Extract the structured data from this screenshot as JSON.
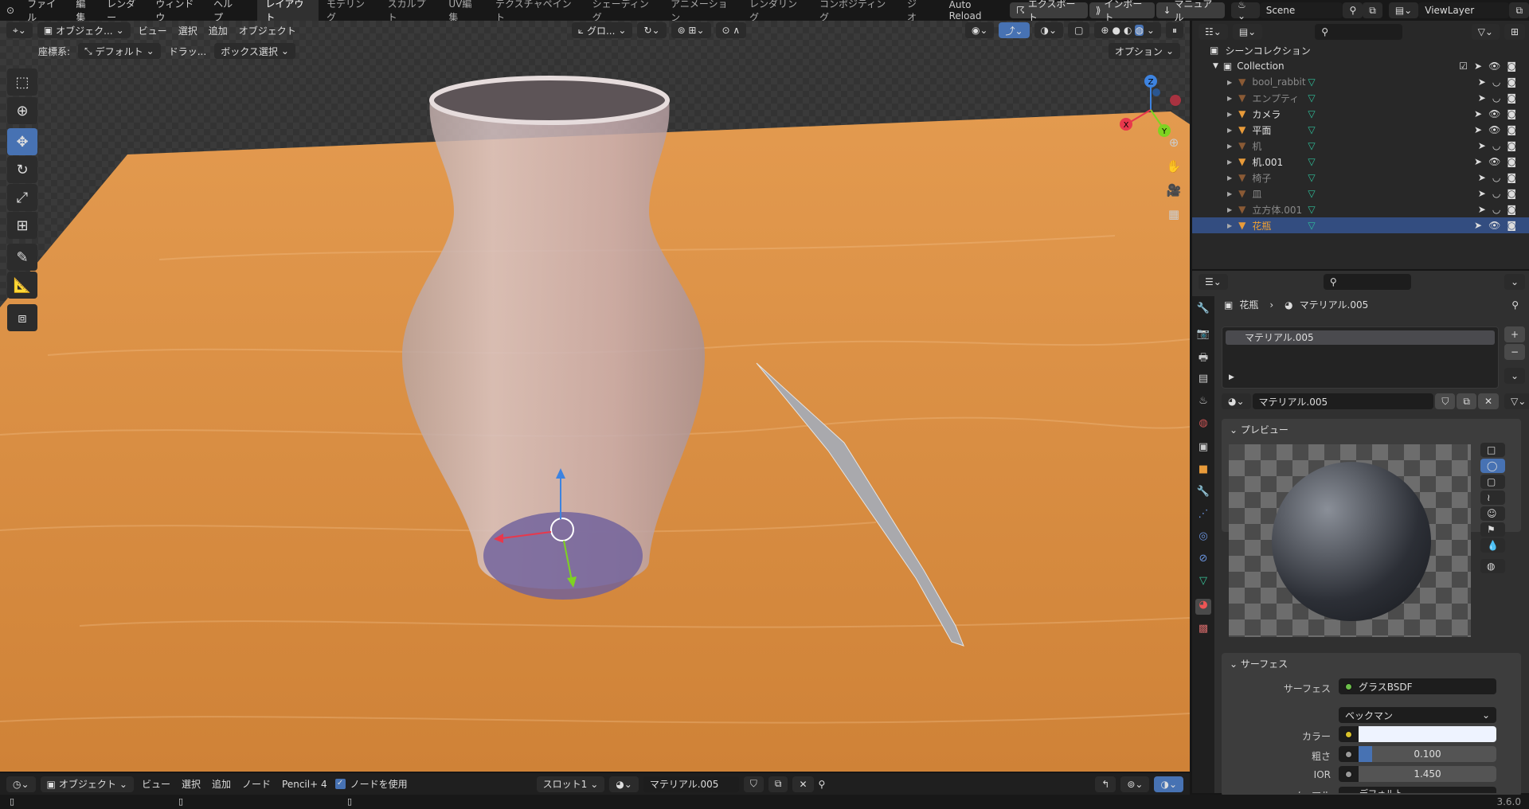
{
  "topbar": {
    "menus": [
      "ファイル",
      "編集",
      "レンダー",
      "ウィンドウ",
      "ヘルプ"
    ],
    "workspaces": [
      "レイアウト",
      "モデリング",
      "スカルプト",
      "UV編集",
      "テクスチャペイント",
      "シェーディング",
      "アニメーション",
      "レンダリング",
      "コンポジティング",
      "ジオ"
    ],
    "active_workspace": "レイアウト",
    "auto_reload": "Auto Reload",
    "export": "エクスポート",
    "import": "インポート",
    "manual": "マニュアル",
    "scene": "Scene",
    "view_layer": "ViewLayer"
  },
  "viewport": {
    "mode": "オブジェク...",
    "menus": [
      "ビュー",
      "選択",
      "追加",
      "オブジェクト"
    ],
    "transform_orientation": "グロ...",
    "coord_label": "座標系:",
    "coord_value": "デフォルト",
    "drag_label": "ドラッ...",
    "select_mode": "ボックス選択",
    "options": "オプション",
    "gizmo": {
      "x": "X",
      "y": "Y",
      "z": "Z"
    },
    "colors": {
      "table": "#d9893f",
      "selected_accent": "#4772b3"
    }
  },
  "outliner": {
    "scene_collection": "シーンコレクション",
    "collection": "Collection",
    "items": [
      {
        "name": "bool_rabbit",
        "dim": true,
        "visible": false
      },
      {
        "name": "エンプティ",
        "dim": true,
        "visible": false
      },
      {
        "name": "カメラ",
        "dim": false,
        "visible": true
      },
      {
        "name": "平面",
        "dim": false,
        "visible": true
      },
      {
        "name": "机",
        "dim": true,
        "visible": false
      },
      {
        "name": "机.001",
        "dim": false,
        "visible": true
      },
      {
        "name": "椅子",
        "dim": true,
        "visible": false
      },
      {
        "name": "皿",
        "dim": true,
        "visible": false
      },
      {
        "name": "立方体.001",
        "dim": true,
        "visible": false
      },
      {
        "name": "花瓶",
        "dim": false,
        "visible": true,
        "selected": true
      }
    ]
  },
  "properties": {
    "object": "花瓶",
    "material": "マテリアル.005",
    "slot_item": "マテリアル.005",
    "material_field": "マテリアル.005",
    "preview_header": "プレビュー",
    "surface_header": "サーフェス",
    "surface_label": "サーフェス",
    "surface_value": "グラスBSDF",
    "distribution": "ベックマン",
    "color_label": "カラー",
    "color_value": "#eef3ff",
    "roughness_label": "粗さ",
    "roughness_value": "0.100",
    "roughness_fraction": 0.1,
    "ior_label": "IOR",
    "ior_value": "1.450",
    "normal_label": "ノーマル",
    "normal_value": "デフォルト"
  },
  "bottom": {
    "mode": "オブジェクト",
    "menus": [
      "ビュー",
      "選択",
      "追加",
      "ノード"
    ],
    "pencil": "Pencil+ 4",
    "use_nodes": "ノードを使用",
    "slot": "スロット1",
    "material": "マテリアル.005"
  },
  "status": {
    "version": "3.6.0"
  }
}
